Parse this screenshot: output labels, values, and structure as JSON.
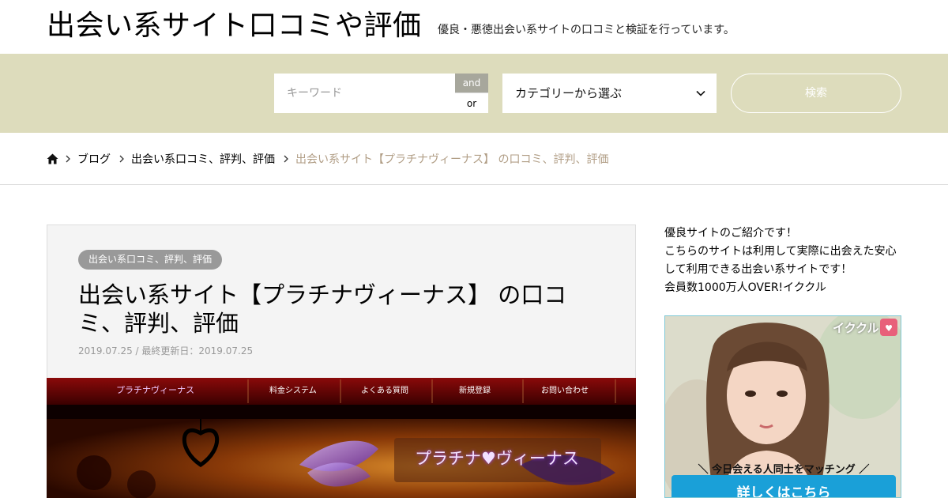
{
  "header": {
    "site_title": "出会い系サイト口コミや評価",
    "site_description": "優良・悪徳出会い系サイトの口コミと検証を行っています。"
  },
  "search": {
    "keyword_placeholder": "キーワード",
    "and_label": "and",
    "or_label": "or",
    "category_selected": "カテゴリーから選ぶ",
    "button_label": "検索"
  },
  "breadcrumb": {
    "items": [
      "ブログ",
      "出会い系口コミ、評判、評価"
    ],
    "current": "出会い系サイト【プラチナヴィーナス】 の口コミ、評判、評価"
  },
  "article": {
    "category": "出会い系口コミ、評判、評価",
    "title": "出会い系サイト【プラチナヴィーナス】 の口コミ、評判、評価",
    "date_line": "2019.07.25 / 最終更新日：2019.07.25",
    "hero": {
      "logo": "プラチナヴィーナス",
      "nav": [
        "料金システム",
        "よくある質問",
        "新規登録",
        "お問い合わせ"
      ],
      "banner_title": "プラチナ♥ヴィーナス"
    }
  },
  "sidebar": {
    "lines": [
      "優良サイトのご紹介です！",
      "こちらのサイトは利用して実際に出会えた安心して利用できる出会い系サイトです！",
      "会員数1000万人OVER!イククル"
    ],
    "ad": {
      "brand": "イククル",
      "tagline": "＼ 今日会える人同士をマッチング ／",
      "cta": "詳しくはこちら"
    }
  },
  "colors": {
    "search_band": "#dddcbc",
    "breadcrumb_current": "#b19e86",
    "badge": "#999999",
    "ad_cta": "#1aa0d8"
  }
}
